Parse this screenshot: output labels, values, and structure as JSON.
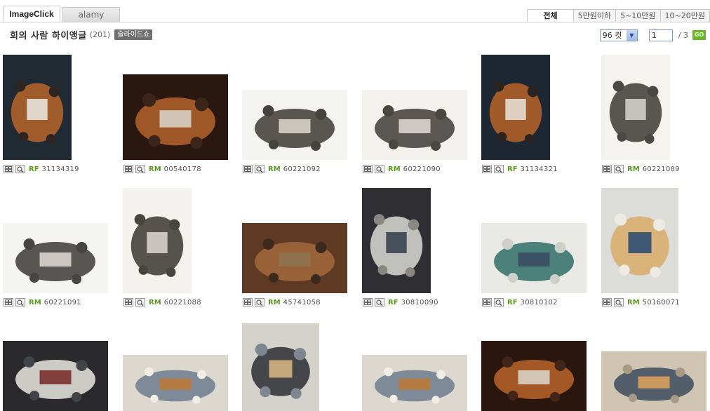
{
  "source_tabs": [
    {
      "label": "ImageClick"
    },
    {
      "label": "alamy"
    }
  ],
  "price_tabs": [
    {
      "label": "전체"
    },
    {
      "label": "5만원이하"
    },
    {
      "label": "5~10만원"
    },
    {
      "label": "10~20만원"
    }
  ],
  "header": {
    "title": "회의 사람 하이앵글",
    "count": "(201)",
    "slideshow_label": "슬라이드쇼"
  },
  "controls": {
    "per_page": "96 컷",
    "page_value": "1",
    "page_total": "/ 3",
    "go_label": "GO"
  },
  "images": [
    {
      "license": "RF",
      "code": "31134319",
      "colors": [
        "#1f2a33",
        "#b8652a",
        "#e7e2da",
        "#2e2522"
      ]
    },
    {
      "license": "RM",
      "code": "00540178",
      "colors": [
        "#2a1810",
        "#b5632b",
        "#d7d0c5",
        "#3b2418"
      ]
    },
    {
      "license": "RM",
      "code": "60221092",
      "colors": [
        "#f4f4f2",
        "#3d3a36",
        "#d8d2c8",
        "#454340"
      ]
    },
    {
      "license": "RM",
      "code": "60221090",
      "colors": [
        "#f2f1ee",
        "#3e3b37",
        "#d9d5cf",
        "#4a4743"
      ]
    },
    {
      "license": "RF",
      "code": "31134321",
      "colors": [
        "#1c2733",
        "#b8652a",
        "#e4ddd2",
        "#2b2320"
      ]
    },
    {
      "license": "RM",
      "code": "60221089",
      "colors": [
        "#f4f3f0",
        "#3b3935",
        "#d2cdc6",
        "#4a4844"
      ]
    },
    {
      "license": "RM",
      "code": "60221091",
      "colors": [
        "#f4f4f2",
        "#3c3a36",
        "#d8d3cb",
        "#474441"
      ]
    },
    {
      "license": "RM",
      "code": "60221088",
      "colors": [
        "#f3f2ef",
        "#3a3733",
        "#d6d1ca",
        "#484541"
      ]
    },
    {
      "license": "RM",
      "code": "45741058",
      "colors": [
        "#5e3a24",
        "#a3683c",
        "#8e7450",
        "#3b2a1c"
      ]
    },
    {
      "license": "RF",
      "code": "30810090",
      "colors": [
        "#2f2f33",
        "#d9d9d6",
        "#3a4450",
        "#8a8782"
      ]
    },
    {
      "license": "RF",
      "code": "30810102",
      "colors": [
        "#e9e9e6",
        "#2f6f66",
        "#3a4d63",
        "#cfcfc9"
      ]
    },
    {
      "license": "RM",
      "code": "50160071",
      "colors": [
        "#dcdcd8",
        "#d8ab6a",
        "#2d4e73",
        "#edeae4"
      ]
    },
    {
      "license": "",
      "code": "",
      "colors": [
        "#2a2a2c",
        "#e9e7e1",
        "#7a2f2a",
        "#404347"
      ]
    },
    {
      "license": "",
      "code": "",
      "colors": [
        "#dcd8cf",
        "#6f7d8f",
        "#ba7a3a",
        "#f0ede6"
      ]
    },
    {
      "license": "",
      "code": "",
      "colors": [
        "#d5d2cb",
        "#2c2e34",
        "#d2b27e",
        "#7f8792"
      ]
    },
    {
      "license": "",
      "code": "",
      "colors": [
        "#dcd8cf",
        "#6f7d8f",
        "#ba7a3a",
        "#f0ede6"
      ]
    },
    {
      "license": "",
      "code": "",
      "colors": [
        "#2a160c",
        "#b9642a",
        "#d9d2c4",
        "#41251a"
      ]
    },
    {
      "license": "",
      "code": "",
      "colors": [
        "#d0c4b2",
        "#3d4c5e",
        "#d8a15d",
        "#a99a86"
      ]
    }
  ]
}
